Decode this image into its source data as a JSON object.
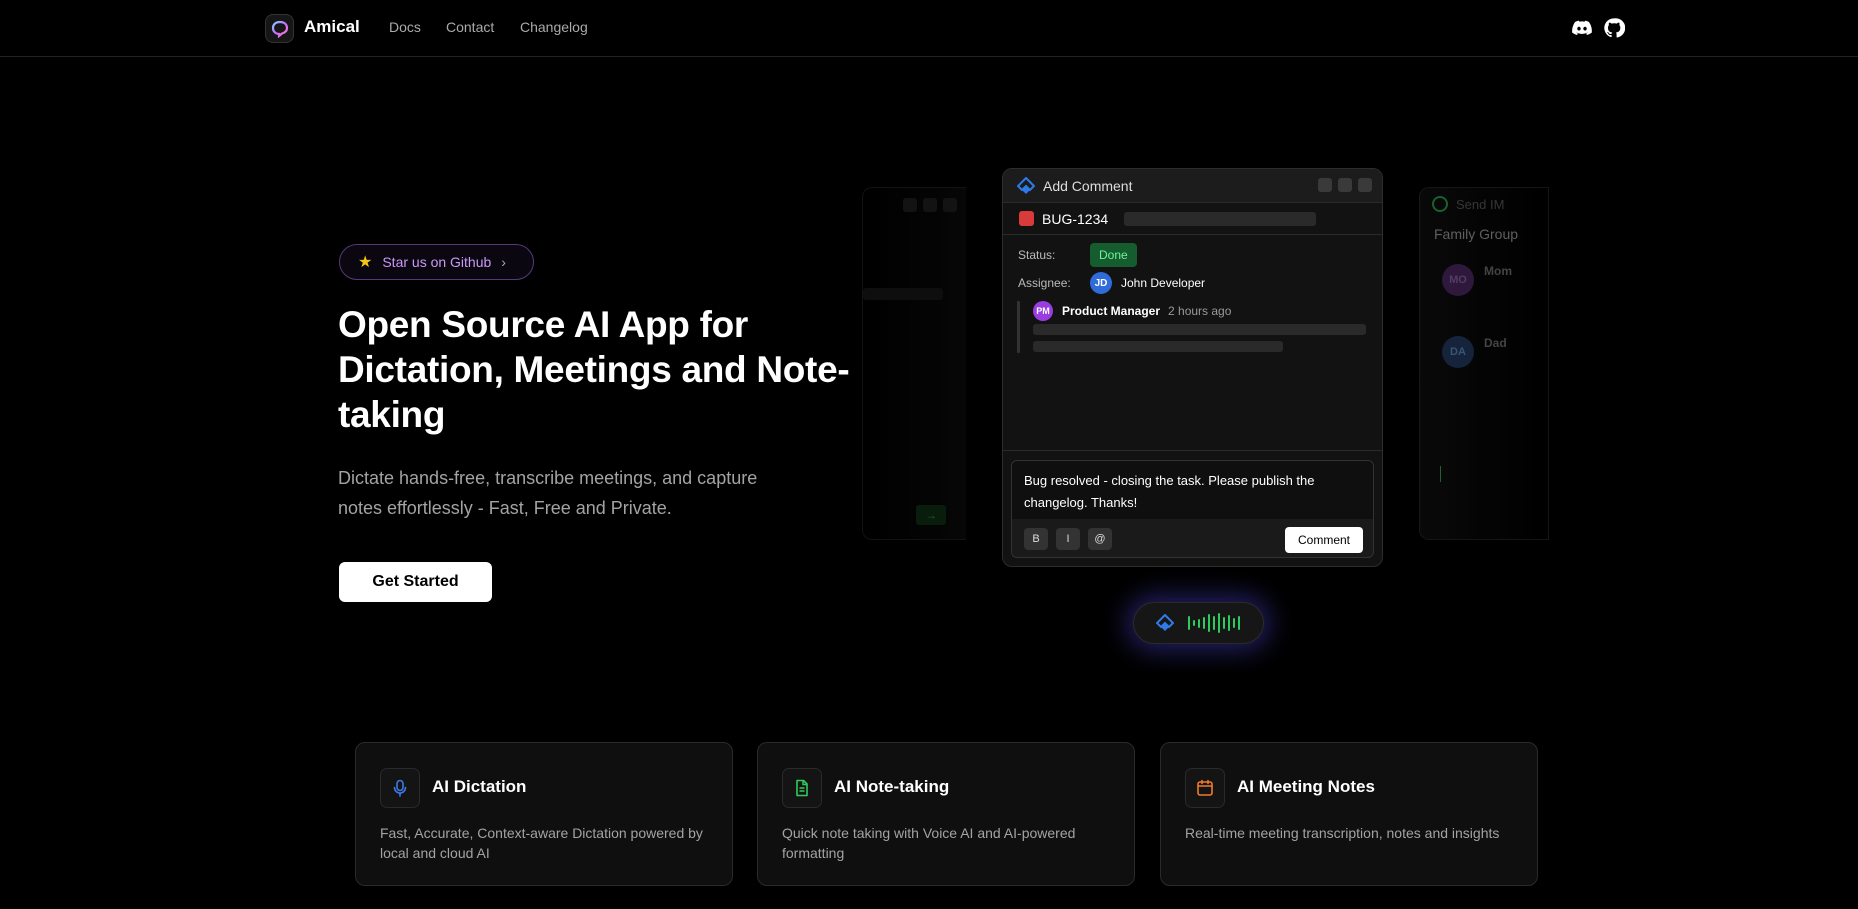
{
  "nav": {
    "brand": "Amical",
    "links": [
      "Docs",
      "Contact",
      "Changelog"
    ],
    "icons": [
      "discord-icon",
      "github-icon"
    ]
  },
  "hero": {
    "star_label": "Star us on Github",
    "title": "Open Source AI App for Dictation, Meetings and Note-taking",
    "subtitle": "Dictate hands-free, transcribe meetings, and capture notes effortlessly - Fast, Free and Private.",
    "cta": "Get Started"
  },
  "mockup": {
    "left_card": {
      "arrow": "→"
    },
    "right_card": {
      "header": "Send IM",
      "group": "Family Group",
      "contacts": [
        {
          "initials": "MO",
          "name": "Mom"
        },
        {
          "initials": "DA",
          "name": "Dad"
        }
      ]
    },
    "main_card": {
      "title": "Add Comment",
      "ticket": "BUG-1234",
      "status_label": "Status:",
      "status_value": "Done",
      "assignee_label": "Assignee:",
      "assignee_initials": "JD",
      "assignee_name": "John Developer",
      "commenter_initials": "PM",
      "commenter_name": "Product Manager",
      "comment_time": "2 hours ago",
      "draft_text": "Bug resolved - closing the task. Please publish the changelog. Thanks!",
      "format_buttons": [
        "B",
        "I",
        "@"
      ],
      "submit": "Comment"
    },
    "colors": {
      "accent_glow": "#5046dc",
      "wave": "#2ecc5c",
      "done_bg": "#155c2e"
    }
  },
  "features": [
    {
      "icon": "microphone-icon",
      "title": "AI Dictation",
      "desc": "Fast, Accurate, Context-aware Dictation powered by local and cloud AI",
      "color": "#3b7ae8"
    },
    {
      "icon": "document-icon",
      "title": "AI Note-taking",
      "desc": "Quick note taking with Voice AI and AI-powered formatting",
      "color": "#2ecc5c"
    },
    {
      "icon": "calendar-icon",
      "title": "AI Meeting Notes",
      "desc": "Real-time meeting transcription, notes and insights",
      "color": "#f07a2a"
    }
  ]
}
